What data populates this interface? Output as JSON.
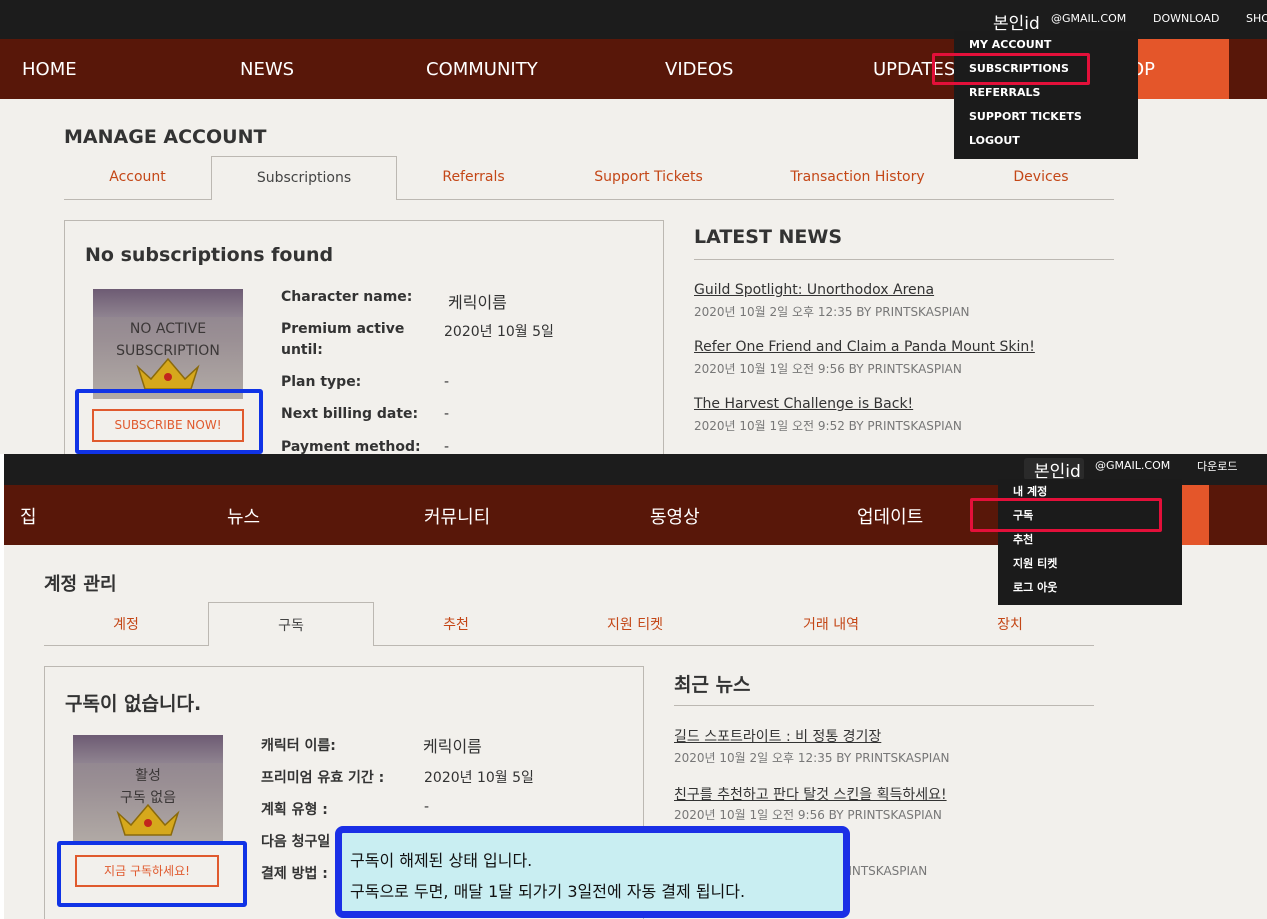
{
  "top": {
    "topbar": {
      "user_id": "본인id",
      "email": "@GMAIL.COM",
      "download": "DOWNLOAD",
      "shop_cut": "SHO"
    },
    "nav": {
      "home": "HOME",
      "news": "NEWS",
      "community": "COMMUNITY",
      "videos": "VIDEOS",
      "updates": "UPDATES",
      "shop_tail": "OP"
    },
    "dropdown": [
      "MY ACCOUNT",
      "SUBSCRIPTIONS",
      "REFERRALS",
      "SUPPORT TICKETS",
      "LOGOUT"
    ],
    "page_title": "MANAGE ACCOUNT",
    "tabs": [
      "Account",
      "Subscriptions",
      "Referrals",
      "Support Tickets",
      "Transaction History",
      "Devices"
    ],
    "card": {
      "title": "No subscriptions found",
      "image_text_1": "NO ACTIVE",
      "image_text_2": "SUBSCRIPTION",
      "subscribe_button": "SUBSCRIBE NOW!",
      "fields": [
        {
          "label": "Character name:",
          "value": "케릭이름"
        },
        {
          "label": "Premium active",
          "label2": "until:",
          "value": "2020년 10월 5일"
        },
        {
          "label": "Plan type:",
          "value": "-"
        },
        {
          "label": "Next billing date:",
          "value": "-"
        },
        {
          "label": "Payment method:",
          "value": "-"
        }
      ]
    },
    "news": {
      "title": "LATEST NEWS",
      "items": [
        {
          "title": "Guild Spotlight: Unorthodox Arena",
          "meta": "2020년 10월 2일 오후 12:35 BY PRINTSKASPIAN"
        },
        {
          "title": "Refer One Friend and Claim a Panda Mount Skin!",
          "meta": "2020년 10월 1일 오전 9:56 BY PRINTSKASPIAN"
        },
        {
          "title": "The Harvest Challenge is Back!",
          "meta": "2020년 10월 1일 오전 9:52 BY PRINTSKASPIAN"
        }
      ]
    }
  },
  "bottom": {
    "topbar": {
      "user_id": "본인id",
      "email": "@GMAIL.COM",
      "download": "다운로드"
    },
    "nav": {
      "home": "집",
      "news": "뉴스",
      "community": "커뮤니티",
      "videos": "동영상",
      "updates": "업데이트"
    },
    "dropdown": [
      "내 계정",
      "구독",
      "추천",
      "지원 티켓",
      "로그 아웃"
    ],
    "page_title": "계정 관리",
    "tabs": [
      "계정",
      "구독",
      "추천",
      "지원 티켓",
      "거래 내역",
      "장치"
    ],
    "card": {
      "title": "구독이 없습니다.",
      "image_text_1": "활성",
      "image_text_2": "구독 없음",
      "subscribe_button": "지금 구독하세요!",
      "fields": [
        {
          "label": "캐릭터 이름:",
          "value": "케릭이름"
        },
        {
          "label": "프리미엄 유효 기간 :",
          "value": "2020년 10월 5일"
        },
        {
          "label": "계획 유형 :",
          "value": "-"
        },
        {
          "label": "다음 청구일",
          "value": ""
        },
        {
          "label": "결제 방법 :",
          "value": ""
        }
      ]
    },
    "news": {
      "title": "최근 뉴스",
      "items": [
        {
          "title": "길드 스포트라이트 : 비 정통 경기장",
          "meta": "2020년 10월 2일 오후 12:35 BY PRINTSKASPIAN"
        },
        {
          "title": "친구를 추천하고 판다 탈것 스킨을 획득하세요!",
          "meta": "2020년 10월 1일 오전 9:56 BY PRINTSKASPIAN"
        },
        {
          "title": "",
          "meta": "RINTSKASPIAN"
        }
      ]
    }
  },
  "annotation": {
    "line1": "구독이 해제된 상태 입니다.",
    "line2": "구독으로 두면, 매달 1달 되가기 3일전에 자동 결제 됩니다."
  },
  "colors": {
    "nav_bg": "#581709",
    "topbar_bg": "#1c1c1c",
    "accent": "#c44717",
    "shop": "#e4562a",
    "highlight_red": "#e3103a",
    "highlight_blue": "#1033e6"
  }
}
